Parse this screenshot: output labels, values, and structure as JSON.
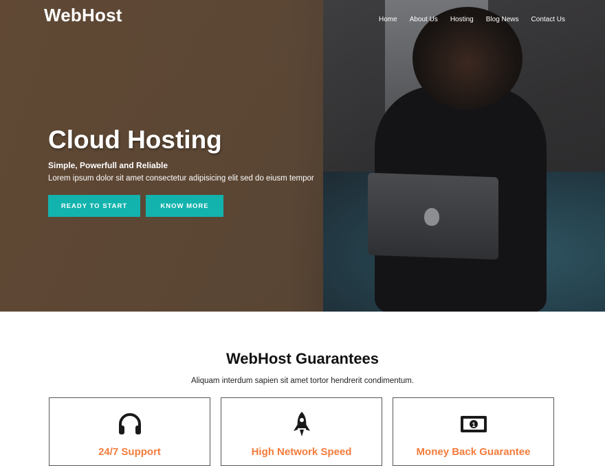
{
  "brand": {
    "name": "WebHost"
  },
  "nav": {
    "items": [
      {
        "label": "Home"
      },
      {
        "label": "About Us"
      },
      {
        "label": "Hosting"
      },
      {
        "label": "Blog News"
      },
      {
        "label": "Contact Us"
      }
    ]
  },
  "hero": {
    "title": "Cloud Hosting",
    "subtitle": "Simple, Powerfull and Reliable",
    "text": "Lorem ipsum dolor sit amet consectetur adipisicing elit sed do eiusm tempor",
    "buttons": {
      "primary": "READY TO START",
      "secondary": "KNOW MORE"
    }
  },
  "guarantees": {
    "title": "WebHost Guarantees",
    "subtitle": "Aliquam interdum sapien sit amet tortor hendrerit condimentum.",
    "cards": [
      {
        "icon": "headphones-icon",
        "title": "24/7 Support"
      },
      {
        "icon": "rocket-icon",
        "title": "High Network Speed"
      },
      {
        "icon": "money-bill-icon",
        "title": "Money Back Guarantee"
      }
    ]
  },
  "colors": {
    "accent": "#13b3ad",
    "card_title": "#f47c3c",
    "hero_overlay": "#5f4834"
  }
}
